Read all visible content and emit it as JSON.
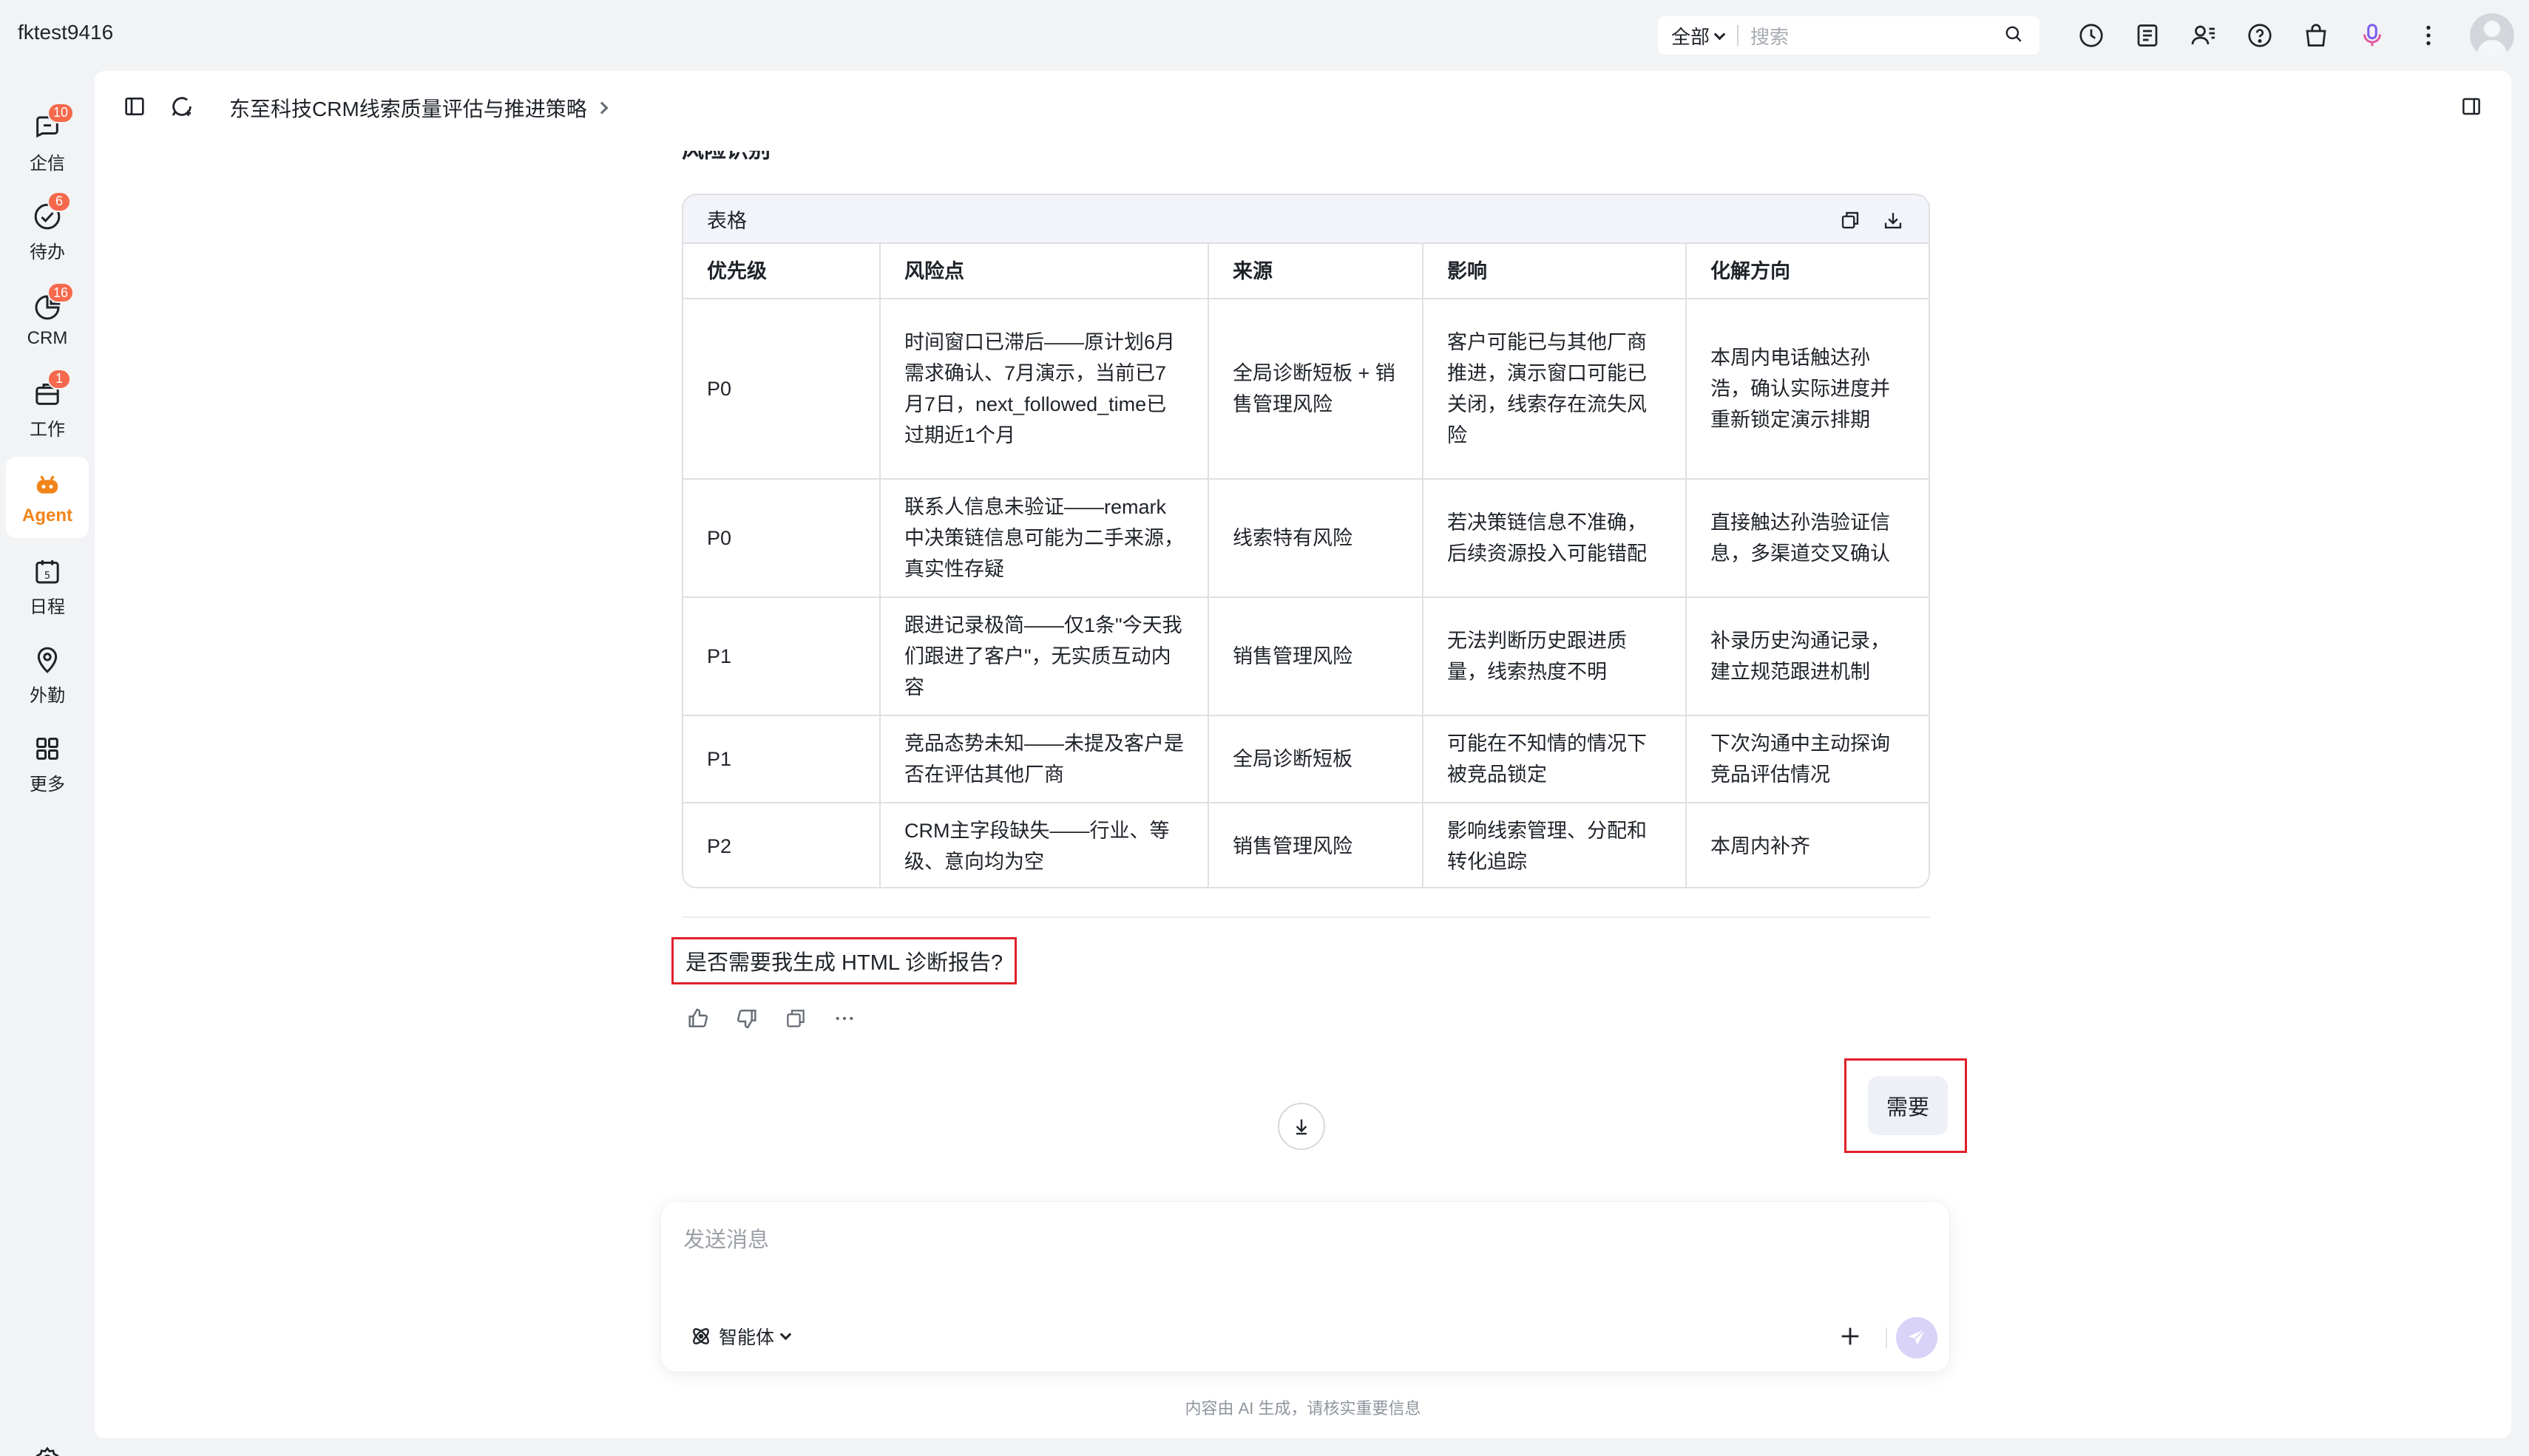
{
  "topbar": {
    "account": "fktest9416",
    "search_scope": "全部",
    "search_placeholder": "搜索"
  },
  "nav": {
    "items": [
      {
        "label": "企信",
        "badge": "10"
      },
      {
        "label": "待办",
        "badge": "6"
      },
      {
        "label": "CRM",
        "badge": "16"
      },
      {
        "label": "工作",
        "badge": "1"
      },
      {
        "label": "Agent",
        "badge": ""
      },
      {
        "label": "日程",
        "badge": ""
      },
      {
        "label": "外勤",
        "badge": ""
      },
      {
        "label": "更多",
        "badge": ""
      }
    ]
  },
  "main": {
    "breadcrumb": "东至科技CRM线索质量评估与推进策略",
    "section_title": "风险识别",
    "table": {
      "title": "表格",
      "columns": [
        "优先级",
        "风险点",
        "来源",
        "影响",
        "化解方向"
      ],
      "rows": [
        [
          "P0",
          "时间窗口已滞后——原计划6月需求确认、7月演示，当前已7月7日，next_followed_time已过期近1个月",
          "全局诊断短板 + 销售管理风险",
          "客户可能已与其他厂商推进，演示窗口可能已关闭，线索存在流失风险",
          "本周内电话触达孙浩，确认实际进度并重新锁定演示排期"
        ],
        [
          "P0",
          "联系人信息未验证——remark中决策链信息可能为二手来源，真实性存疑",
          "线索特有风险",
          "若决策链信息不准确，后续资源投入可能错配",
          "直接触达孙浩验证信息，多渠道交叉确认"
        ],
        [
          "P1",
          "跟进记录极简——仅1条\"今天我们跟进了客户\"，无实质互动内容",
          "销售管理风险",
          "无法判断历史跟进质量，线索热度不明",
          "补录历史沟通记录，建立规范跟进机制"
        ],
        [
          "P1",
          "竞品态势未知——未提及客户是否在评估其他厂商",
          "全局诊断短板",
          "可能在不知情的情况下被竞品锁定",
          "下次沟通中主动探询竞品评估情况"
        ],
        [
          "P2",
          "CRM主字段缺失——行业、等级、意向均为空",
          "销售管理风险",
          "影响线索管理、分配和转化追踪",
          "本周内补齐"
        ]
      ]
    },
    "question": "是否需要我生成 HTML 诊断报告?",
    "user_reply": "需要",
    "composer": {
      "placeholder": "发送消息",
      "agent_label": "智能体"
    },
    "disclaimer": "内容由 AI 生成，请核实重要信息"
  },
  "colors": {
    "accent": "#f08418",
    "badge": "#f5694c",
    "highlight_border": "#e0202a",
    "send_button": "#d8d3f7"
  }
}
